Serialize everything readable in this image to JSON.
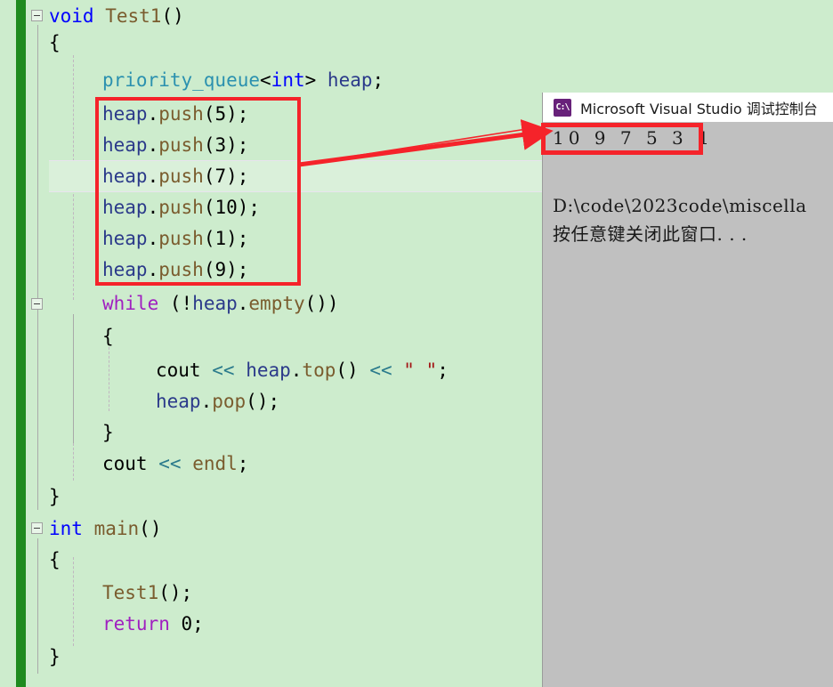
{
  "editor": {
    "background_color": "#cdeccd",
    "change_bar_color": "#1e8a1e",
    "lines": [
      {
        "id": "l1",
        "indent": 0,
        "fold": true,
        "text": "void Test1()"
      },
      {
        "id": "l2",
        "indent": 1,
        "fold": false,
        "text": "{"
      },
      {
        "id": "l3",
        "indent": 2,
        "fold": false,
        "text": "priority_queue<int> heap;"
      },
      {
        "id": "l4",
        "indent": 2,
        "fold": false,
        "text": "heap.push(5);"
      },
      {
        "id": "l5",
        "indent": 2,
        "fold": false,
        "text": "heap.push(3);"
      },
      {
        "id": "l6",
        "indent": 2,
        "fold": false,
        "text": "heap.push(7);",
        "current": true
      },
      {
        "id": "l7",
        "indent": 2,
        "fold": false,
        "text": "heap.push(10);"
      },
      {
        "id": "l8",
        "indent": 2,
        "fold": false,
        "text": "heap.push(1);"
      },
      {
        "id": "l9",
        "indent": 2,
        "fold": false,
        "text": "heap.push(9);"
      },
      {
        "id": "l10",
        "indent": 2,
        "fold": true,
        "text": "while (!heap.empty())"
      },
      {
        "id": "l11",
        "indent": 2,
        "fold": false,
        "text": "{"
      },
      {
        "id": "l12",
        "indent": 3,
        "fold": false,
        "text": "cout << heap.top() << \" \";"
      },
      {
        "id": "l13",
        "indent": 3,
        "fold": false,
        "text": "heap.pop();"
      },
      {
        "id": "l14",
        "indent": 2,
        "fold": false,
        "text": "}"
      },
      {
        "id": "l15",
        "indent": 2,
        "fold": false,
        "text": "cout << endl;"
      },
      {
        "id": "l16",
        "indent": 1,
        "fold": false,
        "text": "}"
      },
      {
        "id": "l17",
        "indent": 0,
        "fold": true,
        "text": "int main()"
      },
      {
        "id": "l18",
        "indent": 1,
        "fold": false,
        "text": "{"
      },
      {
        "id": "l19",
        "indent": 2,
        "fold": false,
        "text": "Test1();"
      },
      {
        "id": "l20",
        "indent": 2,
        "fold": false,
        "text": "return 0;"
      },
      {
        "id": "l21",
        "indent": 1,
        "fold": false,
        "text": "}"
      }
    ],
    "tokens": {
      "void": "void",
      "int": "int",
      "while": "while",
      "return": "return",
      "priority_queue": "priority_queue",
      "cout": "cout",
      "endl": "endl",
      "heap": "heap",
      "Test1": "Test1",
      "main": "main",
      "push": "push",
      "top": "top",
      "pop": "pop",
      "empty": "empty",
      "space_string": "\" \"",
      "zero": "0"
    }
  },
  "annotations": {
    "push_block_highlight_color": "#f5232a",
    "output_highlight_color": "#f5232a",
    "arrow_color": "#f5232a",
    "arrow_from": "heap.push block",
    "arrow_to": "console output line"
  },
  "console": {
    "title": "Microsoft Visual Studio 调试控制台",
    "icon": "console-app-icon",
    "icon_glyph": "C:\\",
    "output_line": "10 9 7 5 3 1",
    "path_line": "D:\\code\\2023code\\miscella",
    "hint_line": "按任意键关闭此窗口. . .",
    "background_color": "#c0c0c0",
    "titlebar_color": "#ffffff"
  }
}
